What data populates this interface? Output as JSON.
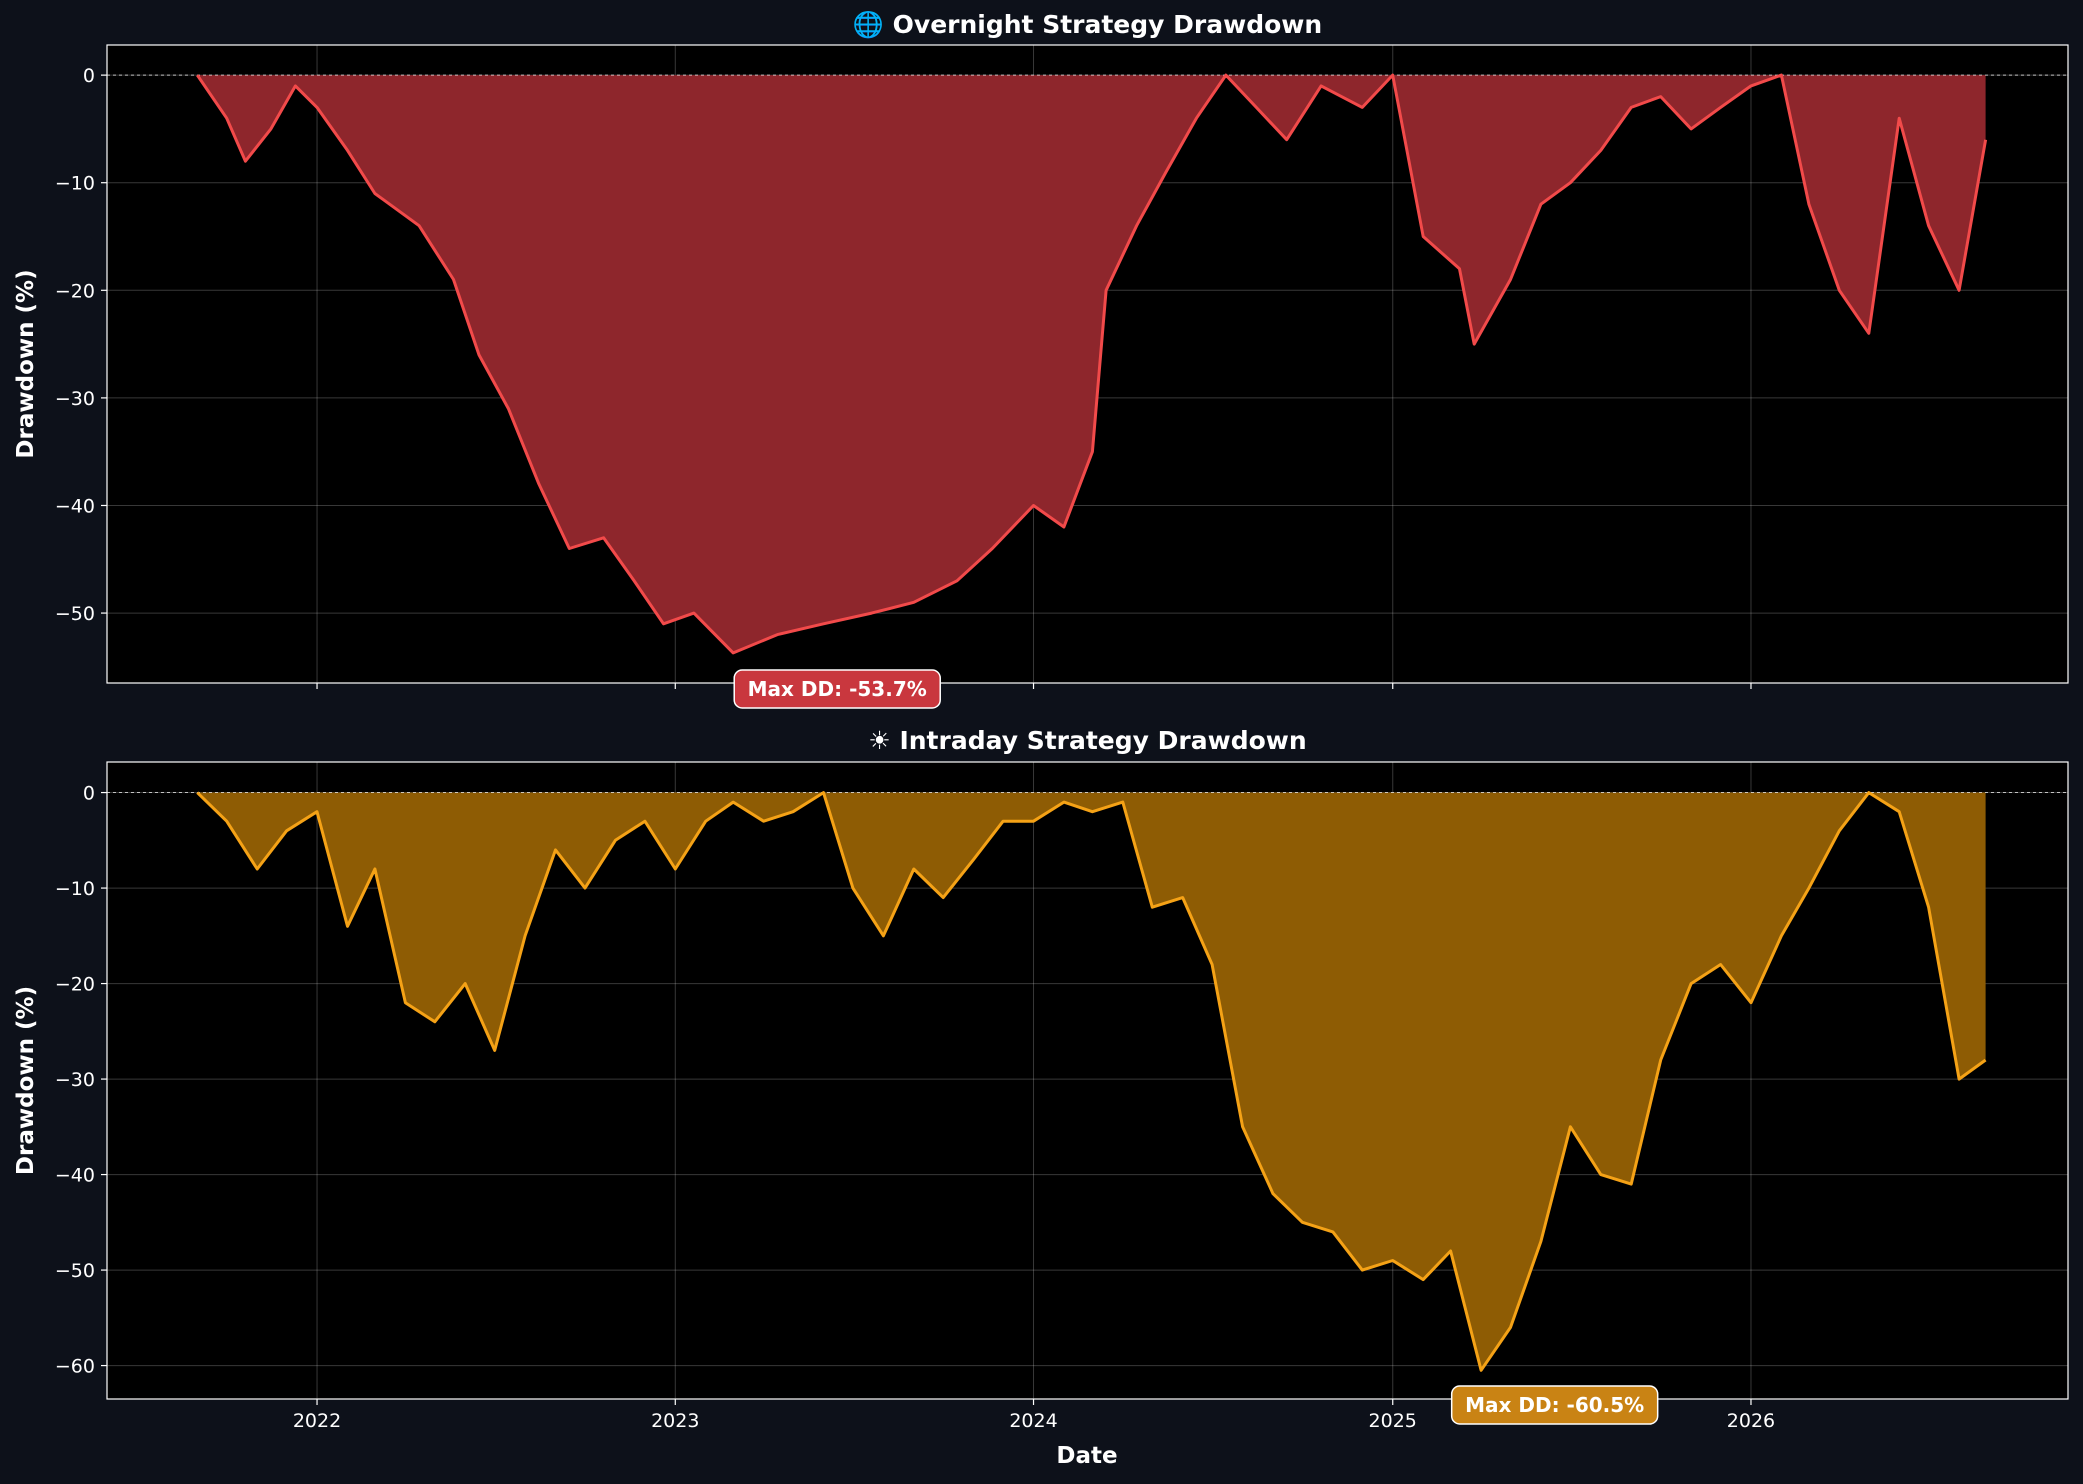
{
  "xlabel": "Date",
  "chart_data": [
    {
      "type": "area",
      "title": "🌐 Overnight Strategy Drawdown",
      "xlabel": "",
      "ylabel": "Drawdown (%)",
      "ylim": [
        -56.5,
        2.8
      ],
      "yticks": [
        0,
        -10,
        -20,
        -30,
        -40,
        -50
      ],
      "ytick_labels": [
        "0",
        "−10",
        "−20",
        "−30",
        "−40",
        "−50"
      ],
      "xlim": [
        "2021-06-01",
        "2026-11-20"
      ],
      "xticks": [
        "2022-01-01",
        "2023-01-01",
        "2024-01-01",
        "2025-01-01",
        "2026-01-01"
      ],
      "xtick_labels": [],
      "grid": true,
      "colors": {
        "line": "#f24a4a",
        "fill": "#8e262c"
      },
      "annotation": {
        "text": "Max DD: -53.7%",
        "x": "2023-06-15",
        "colors": {
          "bg": "#c9373e",
          "border": "#ffffff"
        }
      },
      "series": [
        {
          "name": "",
          "x": [
            "2021-09-01",
            "2021-10-01",
            "2021-10-20",
            "2021-11-15",
            "2021-12-10",
            "2022-01-01",
            "2022-02-01",
            "2022-03-01",
            "2022-04-15",
            "2022-05-20",
            "2022-06-15",
            "2022-07-15",
            "2022-08-15",
            "2022-09-15",
            "2022-10-20",
            "2022-11-20",
            "2022-12-20",
            "2023-01-20",
            "2023-03-01",
            "2023-04-15",
            "2023-06-01",
            "2023-07-20",
            "2023-09-01",
            "2023-10-15",
            "2023-11-20",
            "2024-01-01",
            "2024-02-01",
            "2024-03-01",
            "2024-03-15",
            "2024-04-15",
            "2024-05-15",
            "2024-06-15",
            "2024-07-15",
            "2024-08-15",
            "2024-09-15",
            "2024-10-20",
            "2024-12-01",
            "2025-01-01",
            "2025-02-01",
            "2025-03-10",
            "2025-03-25",
            "2025-05-01",
            "2025-06-01",
            "2025-07-01",
            "2025-08-01",
            "2025-09-01",
            "2025-10-01",
            "2025-11-01",
            "2025-12-01",
            "2026-01-01",
            "2026-02-01",
            "2026-03-01",
            "2026-04-01",
            "2026-05-01",
            "2026-06-01",
            "2026-07-01",
            "2026-08-01",
            "2026-08-28"
          ],
          "values": [
            0,
            -4,
            -8,
            -5,
            -1,
            -3,
            -7,
            -11,
            -14,
            -19,
            -26,
            -31,
            -38,
            -44,
            -43,
            -47,
            -51,
            -50,
            -53.7,
            -52,
            -51,
            -50,
            -49,
            -47,
            -44,
            -40,
            -42,
            -35,
            -20,
            -14,
            -9,
            -4,
            0,
            -3,
            -6,
            -1,
            -3,
            0,
            -15,
            -18,
            -25,
            -19,
            -12,
            -10,
            -7,
            -3,
            -2,
            -5,
            -3,
            -1,
            0,
            -12,
            -20,
            -24,
            -4,
            -14,
            -20,
            -6
          ]
        }
      ]
    },
    {
      "type": "area",
      "title": "☀ Intraday Strategy Drawdown",
      "xlabel": "Date",
      "ylabel": "Drawdown (%)",
      "ylim": [
        -63.5,
        3.2
      ],
      "yticks": [
        0,
        -10,
        -20,
        -30,
        -40,
        -50,
        -60
      ],
      "ytick_labels": [
        "0",
        "−10",
        "−20",
        "−30",
        "−40",
        "−50",
        "−60"
      ],
      "xlim": [
        "2021-06-01",
        "2026-11-20"
      ],
      "xticks": [
        "2022-01-01",
        "2023-01-01",
        "2024-01-01",
        "2025-01-01",
        "2026-01-01"
      ],
      "xtick_labels": [
        "2022",
        "2023",
        "2024",
        "2025",
        "2026"
      ],
      "grid": true,
      "colors": {
        "line": "#f5a216",
        "fill": "#8e5c04"
      },
      "annotation": {
        "text": "Max DD: -60.5%",
        "x": "2025-06-15",
        "colors": {
          "bg": "#c98314",
          "border": "#ffffff"
        }
      },
      "series": [
        {
          "name": "",
          "x": [
            "2021-09-01",
            "2021-10-01",
            "2021-11-01",
            "2021-12-01",
            "2022-01-01",
            "2022-02-01",
            "2022-03-01",
            "2022-04-01",
            "2022-05-01",
            "2022-06-01",
            "2022-07-01",
            "2022-08-01",
            "2022-09-01",
            "2022-10-01",
            "2022-11-01",
            "2022-12-01",
            "2023-01-01",
            "2023-02-01",
            "2023-03-01",
            "2023-04-01",
            "2023-05-01",
            "2023-06-01",
            "2023-07-01",
            "2023-08-01",
            "2023-09-01",
            "2023-10-01",
            "2023-11-01",
            "2023-12-01",
            "2024-01-01",
            "2024-02-01",
            "2024-03-01",
            "2024-04-01",
            "2024-05-01",
            "2024-06-01",
            "2024-07-01",
            "2024-08-01",
            "2024-09-01",
            "2024-10-01",
            "2024-11-01",
            "2024-12-01",
            "2025-01-01",
            "2025-02-01",
            "2025-03-01",
            "2025-04-01",
            "2025-05-01",
            "2025-06-01",
            "2025-07-01",
            "2025-08-01",
            "2025-09-01",
            "2025-10-01",
            "2025-11-01",
            "2025-12-01",
            "2026-01-01",
            "2026-02-01",
            "2026-03-01",
            "2026-04-01",
            "2026-05-01",
            "2026-06-01",
            "2026-07-01",
            "2026-08-01",
            "2026-08-28"
          ],
          "values": [
            0,
            -3,
            -8,
            -4,
            -2,
            -14,
            -8,
            -22,
            -24,
            -20,
            -27,
            -15,
            -6,
            -10,
            -5,
            -3,
            -8,
            -3,
            -1,
            -3,
            -2,
            0,
            -10,
            -15,
            -8,
            -11,
            -7,
            -3,
            -3,
            -1,
            -2,
            -1,
            -12,
            -11,
            -18,
            -35,
            -42,
            -45,
            -46,
            -50,
            -49,
            -51,
            -48,
            -60.5,
            -56,
            -47,
            -35,
            -40,
            -41,
            -28,
            -20,
            -18,
            -22,
            -15,
            -10,
            -4,
            0,
            -2,
            -12,
            -30,
            -28
          ]
        }
      ]
    }
  ]
}
